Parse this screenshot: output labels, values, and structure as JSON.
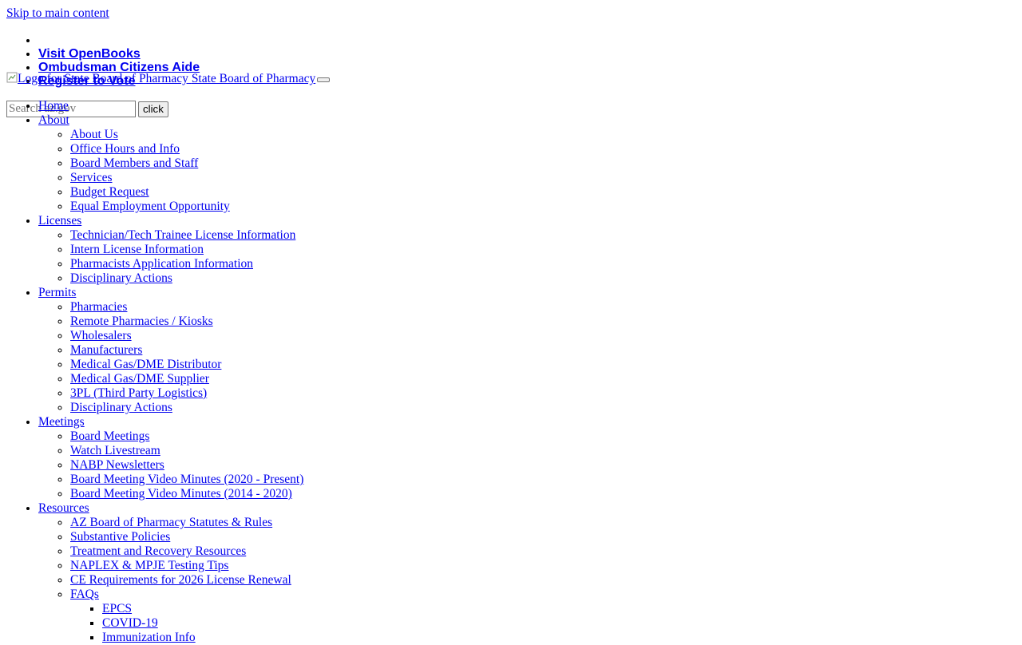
{
  "skip_link": "Skip to main content",
  "top_links": [
    "Visit OpenBooks",
    "Ombudsman Citizens Aide",
    "Register to Vote"
  ],
  "logo": {
    "alt_text": "Logo for State Board of Pharmacy",
    "site_name": "State Board of Pharmacy"
  },
  "search": {
    "placeholder": "Search az.gov",
    "button_label": "click"
  },
  "nav": {
    "home": "Home",
    "about": {
      "label": "About",
      "items": [
        "About Us",
        "Office Hours and Info",
        "Board Members and Staff",
        "Services",
        "Budget Request",
        "Equal Employment Opportunity"
      ]
    },
    "licenses": {
      "label": "Licenses",
      "items": [
        "Technician/Tech Trainee License Information",
        "Intern License Information",
        "Pharmacists Application Information",
        "Disciplinary Actions"
      ]
    },
    "permits": {
      "label": "Permits",
      "items": [
        "Pharmacies",
        "Remote Pharmacies / Kiosks",
        "Wholesalers",
        "Manufacturers",
        "Medical Gas/DME Distributor",
        "Medical Gas/DME Supplier",
        "3PL (Third Party Logistics)",
        "Disciplinary Actions"
      ]
    },
    "meetings": {
      "label": "Meetings",
      "items": [
        "Board Meetings",
        "Watch Livestream",
        "NABP Newsletters",
        "Board Meeting Video Minutes (2020 - Present)",
        "Board Meeting Video Minutes (2014 - 2020)"
      ]
    },
    "resources": {
      "label": "Resources",
      "items": [
        "AZ Board of Pharmacy Statutes & Rules",
        "Substantive Policies",
        "Treatment and Recovery Resources",
        "NAPLEX & MPJE Testing Tips",
        "CE Requirements for 2026 License Renewal"
      ],
      "faqs": {
        "label": "FAQs",
        "items": [
          "EPCS",
          "COVID-19",
          "Immunization Info"
        ]
      }
    }
  }
}
